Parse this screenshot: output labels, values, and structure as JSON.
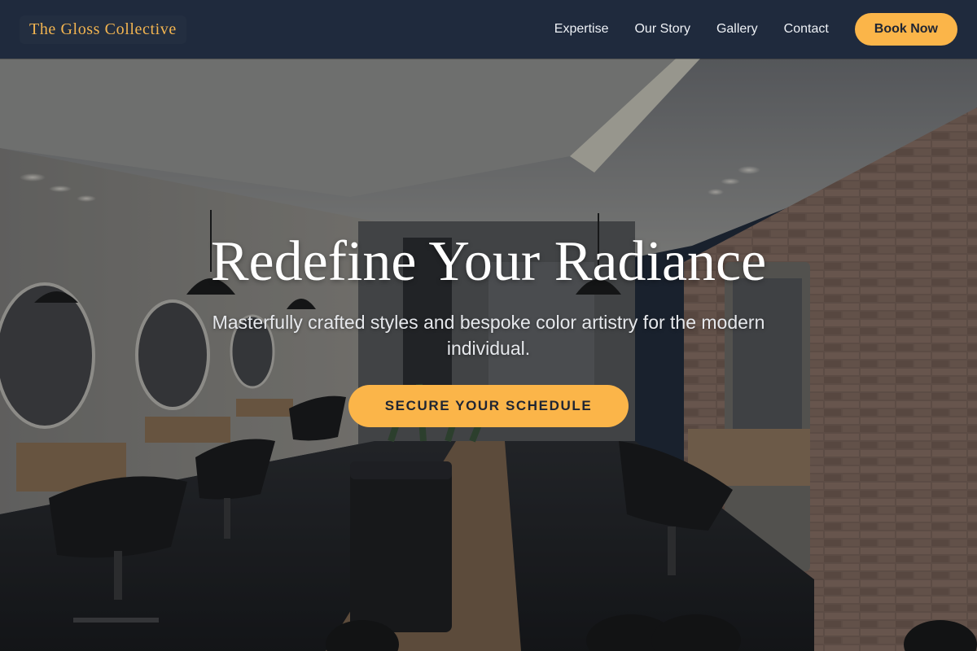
{
  "brand": {
    "name": "The Gloss Collective"
  },
  "nav": {
    "links": [
      "Expertise",
      "Our Story",
      "Gallery",
      "Contact"
    ],
    "cta_label": "Book Now"
  },
  "hero": {
    "title": "Redefine Your Radiance",
    "subtitle": "Masterfully crafted styles and bespoke color artistry for the modern individual.",
    "cta_label": "SECURE YOUR SCHEDULE",
    "background": "salon-interior-photo"
  },
  "colors": {
    "navbar": "#1f2a3d",
    "brand": "#f2b450",
    "accent": "#fbb549",
    "accent_text": "#1f2533"
  }
}
